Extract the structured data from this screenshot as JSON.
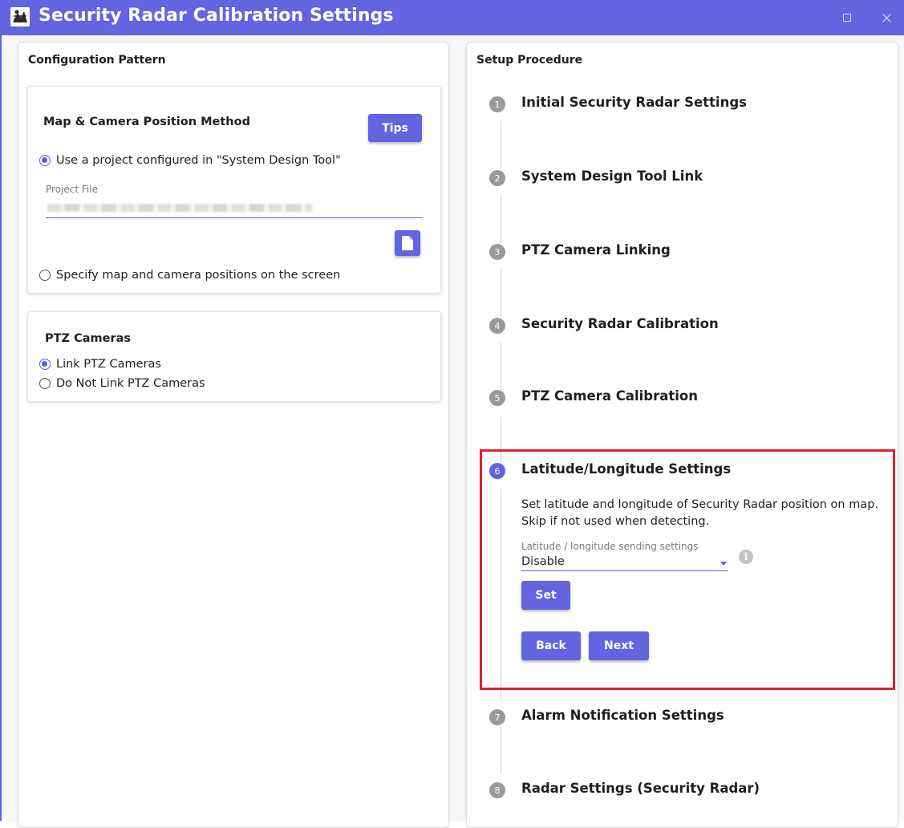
{
  "window": {
    "title": "Security Radar Calibration Settings",
    "accent": "#6264e0",
    "highlight_color": "#e0202a"
  },
  "left_panel": {
    "title": "Configuration Pattern",
    "map_card": {
      "title": "Map & Camera Position Method",
      "tips_label": "Tips",
      "option_project": "Use a project configured in \"System Design Tool\"",
      "project_file_label": "Project File",
      "option_screen": "Specify map and camera positions on the screen",
      "selected": "option_project",
      "file_icon": "file-icon"
    },
    "ptz_card": {
      "title": "PTZ Cameras",
      "option_link": "Link PTZ Cameras",
      "option_no_link": "Do Not Link PTZ Cameras",
      "selected": "option_link"
    }
  },
  "right_panel": {
    "title": "Setup Procedure",
    "steps": [
      {
        "num": "1",
        "label": "Initial Security Radar Settings"
      },
      {
        "num": "2",
        "label": "System Design Tool Link"
      },
      {
        "num": "3",
        "label": "PTZ Camera Linking"
      },
      {
        "num": "4",
        "label": "Security Radar Calibration"
      },
      {
        "num": "5",
        "label": "PTZ Camera Calibration"
      },
      {
        "num": "6",
        "label": "Latitude/Longitude Settings"
      },
      {
        "num": "7",
        "label": "Alarm Notification Settings"
      },
      {
        "num": "8",
        "label": "Radar Settings (Security Radar)"
      }
    ],
    "active_step": 6,
    "active_content": {
      "description_line1": "Set latitude and longitude of Security Radar position on map.",
      "description_line2": "Skip if not used when detecting.",
      "select_label": "Latitude / longitude sending settings",
      "select_value": "Disable",
      "set_label": "Set",
      "back_label": "Back",
      "next_label": "Next",
      "info_icon": "info-icon"
    }
  }
}
